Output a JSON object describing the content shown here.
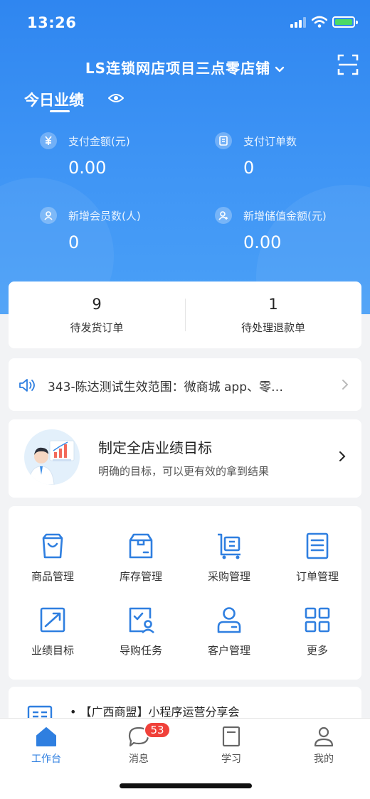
{
  "status_bar": {
    "time": "13:26"
  },
  "header": {
    "store_name": "LS连锁网店项目三点零店铺",
    "section_title": "今日业绩"
  },
  "metrics": [
    {
      "label": "支付金额(元)",
      "value": "0.00",
      "icon": "yen-icon"
    },
    {
      "label": "支付订单数",
      "value": "0",
      "icon": "order-doc-icon"
    },
    {
      "label": "新增会员数(人)",
      "value": "0",
      "icon": "member-icon"
    },
    {
      "label": "新增储值金额(元)",
      "value": "0.00",
      "icon": "stored-value-icon"
    }
  ],
  "orders": [
    {
      "count": "9",
      "label": "待发货订单"
    },
    {
      "count": "1",
      "label": "待处理退款单"
    }
  ],
  "notice": {
    "text": "343-陈达测试生效范围：微商城 app、零…"
  },
  "goal": {
    "title": "制定全店业绩目标",
    "subtitle": "明确的目标，可以更有效的拿到结果"
  },
  "menu": [
    {
      "label": "商品管理",
      "icon": "shopping-bag-icon"
    },
    {
      "label": "库存管理",
      "icon": "inventory-box-icon"
    },
    {
      "label": "采购管理",
      "icon": "purchase-cart-icon"
    },
    {
      "label": "订单管理",
      "icon": "order-list-icon"
    },
    {
      "label": "业绩目标",
      "icon": "trend-chart-icon"
    },
    {
      "label": "导购任务",
      "icon": "guide-task-icon"
    },
    {
      "label": "客户管理",
      "icon": "customer-icon"
    },
    {
      "label": "更多",
      "icon": "grid-more-icon"
    }
  ],
  "news": {
    "text": "• 【广西商盟】小程序运营分享会"
  },
  "tabs": [
    {
      "label": "工作台",
      "icon": "home-icon",
      "active": true
    },
    {
      "label": "消息",
      "icon": "message-icon",
      "badge": "53"
    },
    {
      "label": "学习",
      "icon": "book-icon"
    },
    {
      "label": "我的",
      "icon": "profile-icon"
    }
  ],
  "colors": {
    "primary": "#2f86f0",
    "badge": "#f0413a",
    "icon_blue": "#2f7fe0",
    "battery": "#4cd964"
  }
}
